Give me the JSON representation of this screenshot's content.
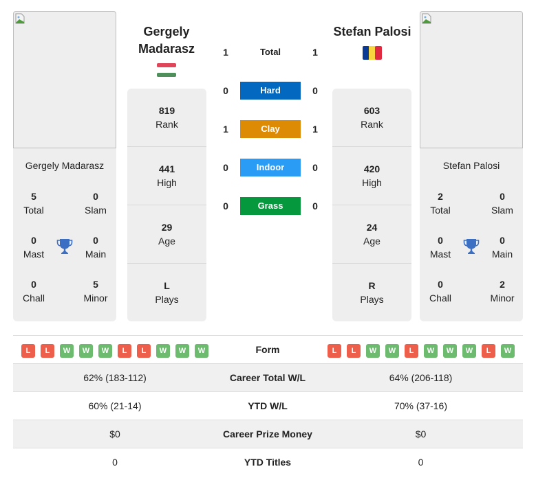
{
  "colors": {
    "hard": "#0369c0",
    "clay": "#dd8a05",
    "indoor": "#2b9cf5",
    "grass": "#06983c",
    "win": "#6cbb6f",
    "loss": "#ed5e4b",
    "trophy": "#3a6fc4"
  },
  "player_left": {
    "name": "Gergely Madarasz",
    "header_name_line1": "Gergely",
    "header_name_line2": "Madarasz",
    "flag": "hungary-flag",
    "photo_alt": "broken-image-icon",
    "titles": {
      "total": {
        "value": "5",
        "label": "Total"
      },
      "slam": {
        "value": "0",
        "label": "Slam"
      },
      "mast": {
        "value": "0",
        "label": "Mast"
      },
      "main": {
        "value": "0",
        "label": "Main"
      },
      "chall": {
        "value": "0",
        "label": "Chall"
      },
      "minor": {
        "value": "5",
        "label": "Minor"
      }
    },
    "info": {
      "rank": {
        "value": "819",
        "label": "Rank"
      },
      "high": {
        "value": "441",
        "label": "High"
      },
      "age": {
        "value": "29",
        "label": "Age"
      },
      "plays": {
        "value": "L",
        "label": "Plays"
      }
    },
    "form": [
      "L",
      "L",
      "W",
      "W",
      "W",
      "L",
      "L",
      "W",
      "W",
      "W"
    ]
  },
  "player_right": {
    "name": "Stefan Palosi",
    "header_name_line1": "Stefan Palosi",
    "flag": "romania-flag",
    "photo_alt": "broken-image-icon",
    "titles": {
      "total": {
        "value": "2",
        "label": "Total"
      },
      "slam": {
        "value": "0",
        "label": "Slam"
      },
      "mast": {
        "value": "0",
        "label": "Mast"
      },
      "main": {
        "value": "0",
        "label": "Main"
      },
      "chall": {
        "value": "0",
        "label": "Chall"
      },
      "minor": {
        "value": "2",
        "label": "Minor"
      }
    },
    "info": {
      "rank": {
        "value": "603",
        "label": "Rank"
      },
      "high": {
        "value": "420",
        "label": "High"
      },
      "age": {
        "value": "24",
        "label": "Age"
      },
      "plays": {
        "value": "R",
        "label": "Plays"
      }
    },
    "form": [
      "L",
      "L",
      "W",
      "W",
      "L",
      "W",
      "W",
      "W",
      "L",
      "W"
    ]
  },
  "h2h": [
    {
      "label": "Total",
      "left": "1",
      "right": "1"
    },
    {
      "label": "Hard",
      "left": "0",
      "right": "0"
    },
    {
      "label": "Clay",
      "left": "1",
      "right": "1"
    },
    {
      "label": "Indoor",
      "left": "0",
      "right": "0"
    },
    {
      "label": "Grass",
      "left": "0",
      "right": "0"
    }
  ],
  "stats": [
    {
      "label": "Form",
      "left": "",
      "right": ""
    },
    {
      "label": "Career Total W/L",
      "left": "62% (183-112)",
      "right": "64% (206-118)"
    },
    {
      "label": "YTD W/L",
      "left": "60% (21-14)",
      "right": "70% (37-16)"
    },
    {
      "label": "Career Prize Money",
      "left": "$0",
      "right": "$0"
    },
    {
      "label": "YTD Titles",
      "left": "0",
      "right": "0"
    }
  ]
}
